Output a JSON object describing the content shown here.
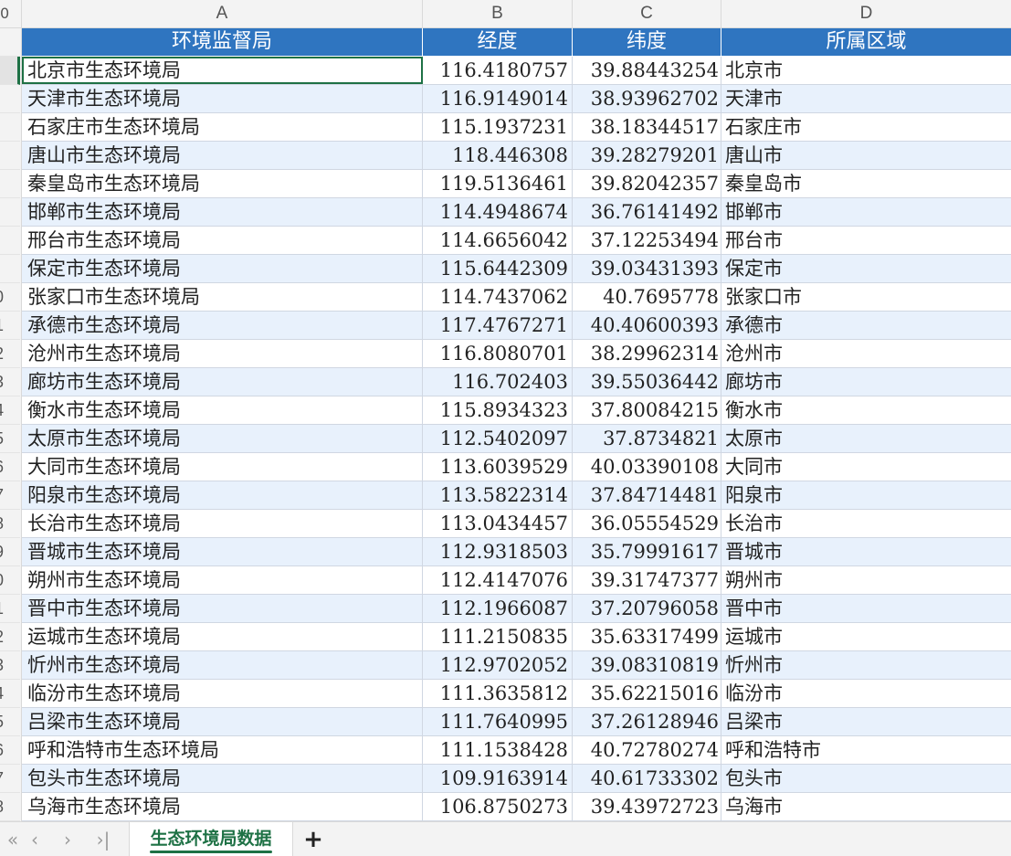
{
  "columns": [
    "A",
    "B",
    "C",
    "D"
  ],
  "corner": "0",
  "header": {
    "agency": "环境监督局",
    "longitude": "经度",
    "latitude": "纬度",
    "region": "所属区域"
  },
  "row_numbers": [
    "",
    "",
    "",
    "",
    "",
    "",
    "",
    "",
    "0",
    "1",
    "2",
    "3",
    "4",
    "5",
    "6",
    "7",
    "8",
    "9",
    "0",
    "1",
    "2",
    "3",
    "4",
    "5",
    "6",
    "7",
    "8"
  ],
  "rows": [
    {
      "agency": "北京市生态环境局",
      "lon": "116.4180757",
      "lat": "39.88443254",
      "region": "北京市"
    },
    {
      "agency": "天津市生态环境局",
      "lon": "116.9149014",
      "lat": "38.93962702",
      "region": "天津市"
    },
    {
      "agency": "石家庄市生态环境局",
      "lon": "115.1937231",
      "lat": "38.18344517",
      "region": "石家庄市"
    },
    {
      "agency": "唐山市生态环境局",
      "lon": "118.446308",
      "lat": "39.28279201",
      "region": "唐山市"
    },
    {
      "agency": "秦皇岛市生态环境局",
      "lon": "119.5136461",
      "lat": "39.82042357",
      "region": "秦皇岛市"
    },
    {
      "agency": "邯郸市生态环境局",
      "lon": "114.4948674",
      "lat": "36.76141492",
      "region": "邯郸市"
    },
    {
      "agency": "邢台市生态环境局",
      "lon": "114.6656042",
      "lat": "37.12253494",
      "region": "邢台市"
    },
    {
      "agency": "保定市生态环境局",
      "lon": "115.6442309",
      "lat": "39.03431393",
      "region": "保定市"
    },
    {
      "agency": "张家口市生态环境局",
      "lon": "114.7437062",
      "lat": "40.7695778",
      "region": "张家口市"
    },
    {
      "agency": "承德市生态环境局",
      "lon": "117.4767271",
      "lat": "40.40600393",
      "region": "承德市"
    },
    {
      "agency": "沧州市生态环境局",
      "lon": "116.8080701",
      "lat": "38.29962314",
      "region": "沧州市"
    },
    {
      "agency": "廊坊市生态环境局",
      "lon": "116.702403",
      "lat": "39.55036442",
      "region": "廊坊市"
    },
    {
      "agency": "衡水市生态环境局",
      "lon": "115.8934323",
      "lat": "37.80084215",
      "region": "衡水市"
    },
    {
      "agency": "太原市生态环境局",
      "lon": "112.5402097",
      "lat": "37.8734821",
      "region": "太原市"
    },
    {
      "agency": "大同市生态环境局",
      "lon": "113.6039529",
      "lat": "40.03390108",
      "region": "大同市"
    },
    {
      "agency": "阳泉市生态环境局",
      "lon": "113.5822314",
      "lat": "37.84714481",
      "region": "阳泉市"
    },
    {
      "agency": "长治市生态环境局",
      "lon": "113.0434457",
      "lat": "36.05554529",
      "region": "长治市"
    },
    {
      "agency": "晋城市生态环境局",
      "lon": "112.9318503",
      "lat": "35.79991617",
      "region": "晋城市"
    },
    {
      "agency": "朔州市生态环境局",
      "lon": "112.4147076",
      "lat": "39.31747377",
      "region": "朔州市"
    },
    {
      "agency": "晋中市生态环境局",
      "lon": "112.1966087",
      "lat": "37.20796058",
      "region": "晋中市"
    },
    {
      "agency": "运城市生态环境局",
      "lon": "111.2150835",
      "lat": "35.63317499",
      "region": "运城市"
    },
    {
      "agency": "忻州市生态环境局",
      "lon": "112.9702052",
      "lat": "39.08310819",
      "region": "忻州市"
    },
    {
      "agency": "临汾市生态环境局",
      "lon": "111.3635812",
      "lat": "35.62215016",
      "region": "临汾市"
    },
    {
      "agency": "吕梁市生态环境局",
      "lon": "111.7640995",
      "lat": "37.26128946",
      "region": "吕梁市"
    },
    {
      "agency": "呼和浩特市生态环境局",
      "lon": "111.1538428",
      "lat": "40.72780274",
      "region": "呼和浩特市"
    },
    {
      "agency": "包头市生态环境局",
      "lon": "109.9163914",
      "lat": "40.61733302",
      "region": "包头市"
    },
    {
      "agency": "乌海市生态环境局",
      "lon": "106.8750273",
      "lat": "39.43972723",
      "region": "乌海市"
    }
  ],
  "tabbar": {
    "nav": {
      "first": "«",
      "prev": "‹",
      "next": "›",
      "last": "›|"
    },
    "sheet_name": "生态环境局数据",
    "add_label": "+"
  },
  "colors": {
    "header_fill": "#2f75c0",
    "stripe_fill": "#e8f1fc",
    "accent": "#1e7145"
  }
}
